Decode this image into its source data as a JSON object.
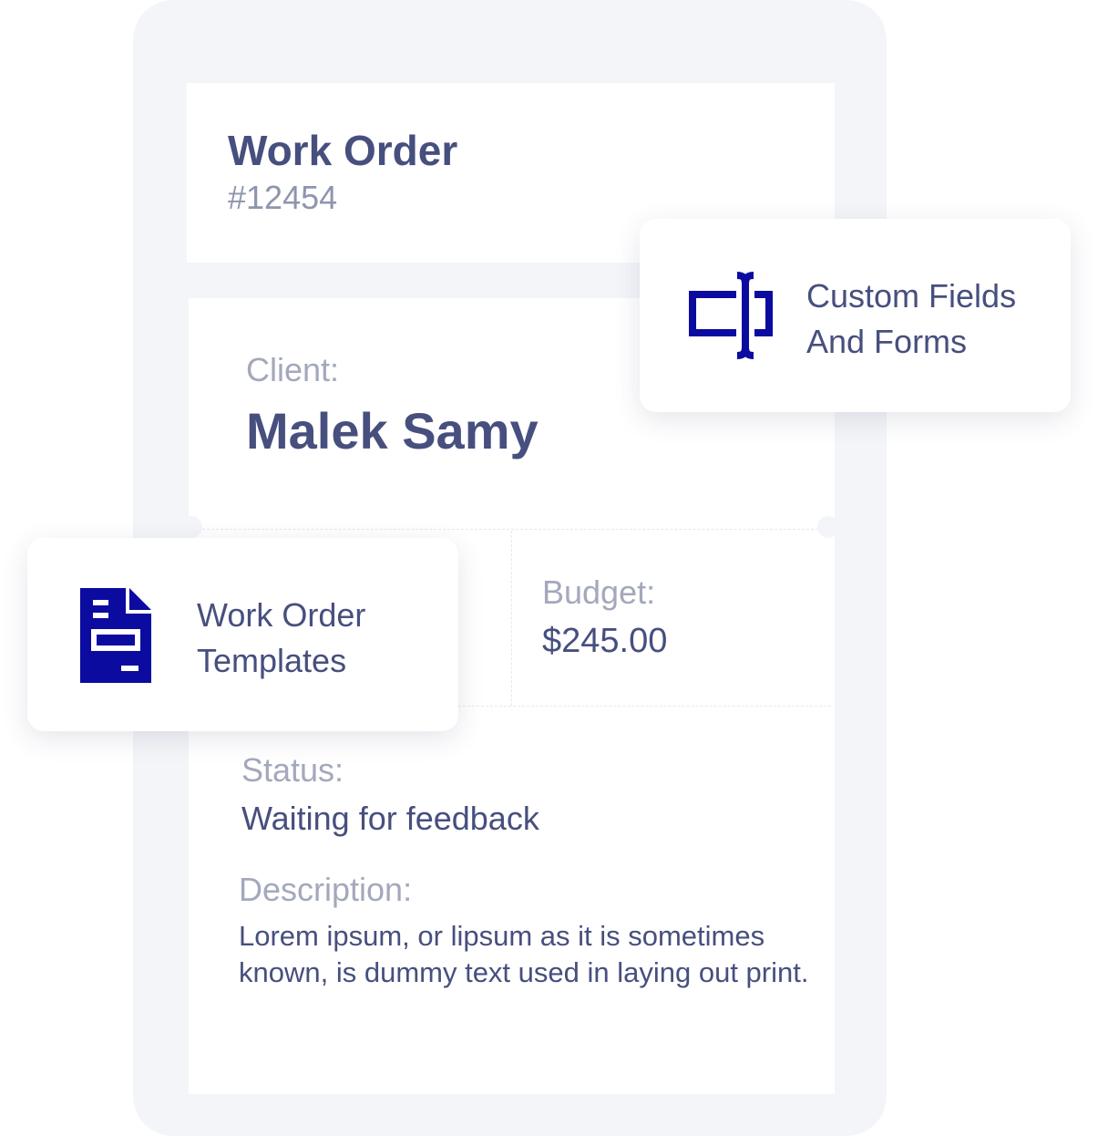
{
  "work_order": {
    "title": "Work Order",
    "number": "#12454"
  },
  "client": {
    "label": "Client:",
    "name": "Malek Samy"
  },
  "budget": {
    "label": "Budget:",
    "value": "$245.00"
  },
  "status": {
    "label": "Status:",
    "value": "Waiting for feedback"
  },
  "description": {
    "label": "Description:",
    "text": "Lorem ipsum, or lipsum as it is sometimes known, is dummy text used in laying out print."
  },
  "features": {
    "custom_fields": {
      "line1": "Custom Fields",
      "line2": "And Forms",
      "icon": "text-cursor-field-icon"
    },
    "templates": {
      "line1": "Work Order",
      "line2": "Templates",
      "icon": "document-template-icon"
    }
  },
  "colors": {
    "accent": "#0b0ba0",
    "text_dark": "#474f7e",
    "text_muted": "#a3a8bc",
    "frame": "#f3f5f8"
  }
}
